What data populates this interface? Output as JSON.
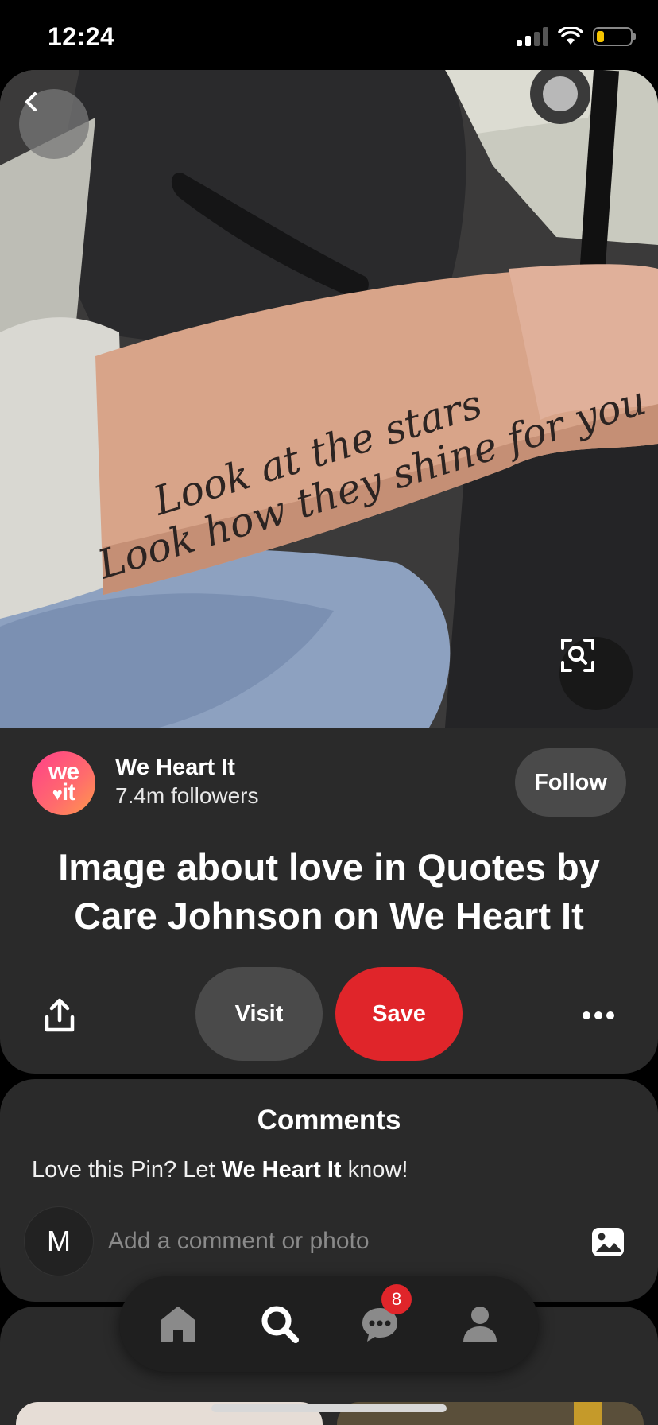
{
  "status_bar": {
    "time": "12:24",
    "icons": [
      "cellular-signal-icon",
      "wifi-icon",
      "battery-low-icon"
    ],
    "battery_color": "#f5c400"
  },
  "pin": {
    "image_text_line1": "Look at the stars",
    "image_text_line2": "Look how they shine for you",
    "back_icon": "chevron-left-icon",
    "visual_search_icon": "visual-search-icon",
    "creator": {
      "avatar_line1": "we",
      "avatar_line2": "it",
      "name": "We Heart It",
      "followers": "7.4m followers",
      "follow_label": "Follow"
    },
    "title": "Image about love in Quotes by Care Johnson on We Heart It",
    "actions": {
      "share_icon": "share-icon",
      "visit_label": "Visit",
      "save_label": "Save",
      "more_icon": "more-icon",
      "save_color": "#e0252a"
    }
  },
  "comments": {
    "title": "Comments",
    "prompt_before": "Love this Pin? Let ",
    "prompt_name": "We Heart It",
    "prompt_after": " know!",
    "avatar_initial": "M",
    "input_placeholder": "Add a comment or photo",
    "photo_icon": "image-icon"
  },
  "nav": {
    "items": [
      {
        "name": "home",
        "icon": "home-icon"
      },
      {
        "name": "search",
        "icon": "search-icon",
        "active": true
      },
      {
        "name": "messages",
        "icon": "chat-icon",
        "badge": "8"
      },
      {
        "name": "profile",
        "icon": "profile-icon"
      }
    ]
  }
}
